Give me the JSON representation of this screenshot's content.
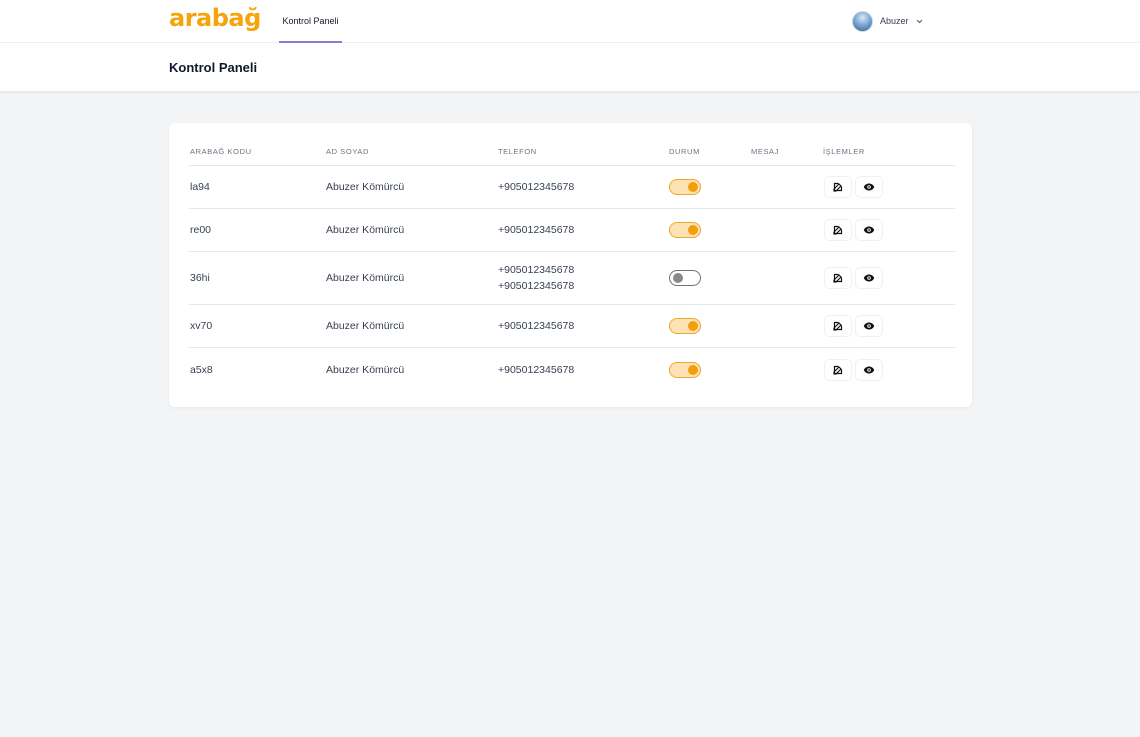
{
  "nav": {
    "logo": "arabağ",
    "tab_label": "Kontrol Paneli",
    "user_name": "Abuzer"
  },
  "page": {
    "title": "Kontrol Paneli"
  },
  "table": {
    "headers": [
      "ARABAĞ KODU",
      "AD SOYAD",
      "TELEFON",
      "DURUM",
      "MESAJ",
      "İŞLEMLER"
    ],
    "rows": [
      {
        "code": "la94",
        "name": "Abuzer Kömürcü",
        "phones": [
          "+905012345678"
        ],
        "status_on": true,
        "message": ""
      },
      {
        "code": "re00",
        "name": "Abuzer Kömürcü",
        "phones": [
          "+905012345678"
        ],
        "status_on": true,
        "message": ""
      },
      {
        "code": "36hi",
        "name": "Abuzer Kömürcü",
        "phones": [
          "+905012345678",
          "+905012345678"
        ],
        "status_on": false,
        "message": ""
      },
      {
        "code": "xv70",
        "name": "Abuzer Kömürcü",
        "phones": [
          "+905012345678"
        ],
        "status_on": true,
        "message": ""
      },
      {
        "code": "a5x8",
        "name": "Abuzer Kömürcü",
        "phones": [
          "+905012345678"
        ],
        "status_on": true,
        "message": ""
      }
    ]
  },
  "colors": {
    "accent": "#f59e0b",
    "nav_indicator": "#8b7fd4",
    "background": "#f3f4f6"
  },
  "icons": {
    "edit": "edit-icon",
    "view": "eye-icon",
    "chevron": "chevron-down-icon"
  }
}
